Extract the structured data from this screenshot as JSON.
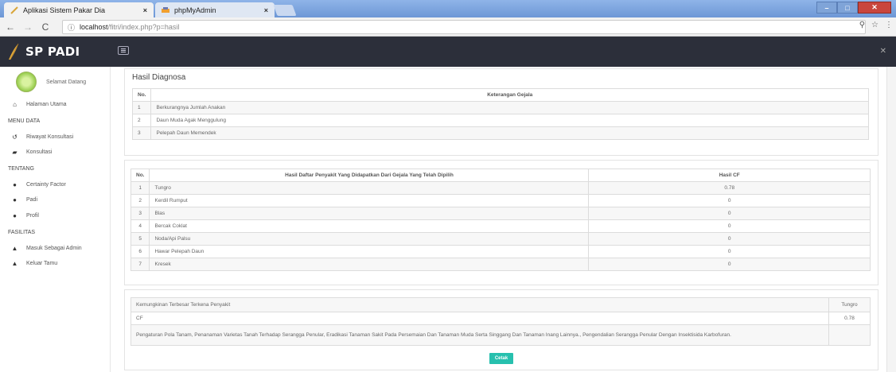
{
  "browser": {
    "tabs": [
      {
        "title": "Aplikasi Sistem Pakar Dia",
        "close": "×"
      },
      {
        "title": "phpMyAdmin",
        "close": "×"
      }
    ],
    "window_buttons": {
      "minimize": "–",
      "maximize": "□",
      "close": "✕"
    },
    "url_host": "localhost",
    "url_path": "/fitri/index.php?p=hasil"
  },
  "app": {
    "brand": "SP PADI"
  },
  "sidebar": {
    "welcome": "Selamat Datang",
    "home": "Halaman Utama",
    "section_menu": "MENU DATA",
    "riwayat": "Riwayat Konsultasi",
    "konsultasi": "Konsultasi",
    "section_tentang": "TENTANG",
    "certainty": "Certainty Factor",
    "padi": "Padi",
    "profil": "Profil",
    "section_fasilitas": "FASILITAS",
    "admin": "Masuk Sebagai Admin",
    "keluar": "Keluar Tamu"
  },
  "diagnosa": {
    "title": "Hasil Diagnosa",
    "col_no": "No.",
    "col_gejala": "Keterangan Gejala",
    "rows": [
      {
        "no": "1",
        "gejala": "Berkurangnya Jumlah Anakan"
      },
      {
        "no": "2",
        "gejala": "Daun Muda Agak Menggulung"
      },
      {
        "no": "3",
        "gejala": "Pelepah Daun Memendek"
      }
    ]
  },
  "penyakit": {
    "col_no": "No.",
    "col_name": "Hasil Daftar Penyakit Yang Didapatkan Dari Gejala Yang Telah Dipilih",
    "col_cf": "Hasil CF",
    "rows": [
      {
        "no": "1",
        "name": "Tungro",
        "cf": "0.78"
      },
      {
        "no": "2",
        "name": "Kerdil Rumput",
        "cf": "0"
      },
      {
        "no": "3",
        "name": "Blas",
        "cf": "0"
      },
      {
        "no": "4",
        "name": "Bercak Coklat",
        "cf": "0"
      },
      {
        "no": "5",
        "name": "Noda/Api Palsu",
        "cf": "0"
      },
      {
        "no": "6",
        "name": "Hawar Pelepah Daun",
        "cf": "0"
      },
      {
        "no": "7",
        "name": "Kresek",
        "cf": "0"
      }
    ]
  },
  "kesimpulan": {
    "label": "Kemungkinan Terbesar Terkena Penyakit",
    "value": "Tungro",
    "cf_label": "CF",
    "cf_value": "0.78",
    "solusi": "Pengaturan Pola Tanam, Penanaman Varietas Tanah Terhadap Serangga Penular, Eradikasi Tanaman Sakit Pada Persemaian Dan Tanaman Muda Serta Singgang Dan Tanaman Inang Lainnya., Pengendalian Serangga Penular Dengan Insektisida Karbofuran."
  },
  "button": {
    "cetak": "Cetak"
  }
}
